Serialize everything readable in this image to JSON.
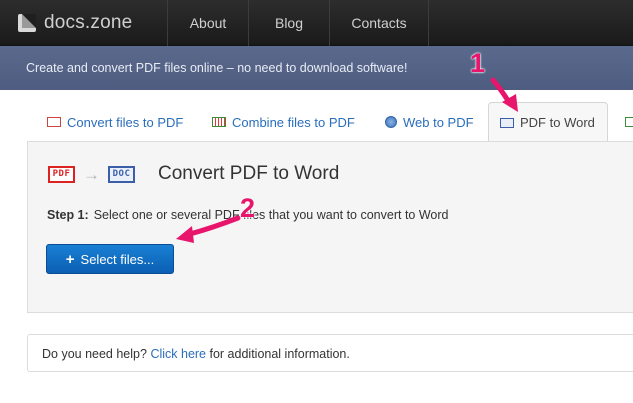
{
  "header": {
    "logo_text": "docs.zone",
    "nav": [
      {
        "label": "About"
      },
      {
        "label": "Blog"
      },
      {
        "label": "Contacts"
      }
    ]
  },
  "banner": {
    "text": "Create and convert PDF files online – no need to download software!"
  },
  "tabs": [
    {
      "label": "Convert files to PDF",
      "icon": "pdf-file-icon"
    },
    {
      "label": "Combine files to PDF",
      "icon": "combine-files-icon"
    },
    {
      "label": "Web to PDF",
      "icon": "web-globe-icon"
    },
    {
      "label": "PDF to Word",
      "icon": "doc-file-icon",
      "active": true
    }
  ],
  "panel": {
    "icon_from": "PDF",
    "icon_to": "DOC",
    "title": "Convert PDF to Word",
    "step_label": "Step 1:",
    "step_text": "Select one or several PDF files that you want to convert to Word",
    "select_button": "Select files..."
  },
  "help": {
    "prefix": "Do you need help?",
    "link": "Click here",
    "suffix": "for additional information."
  },
  "annotations": {
    "one": "1",
    "two": "2",
    "color": "#e8156c"
  },
  "colors": {
    "nav_bg": "#1f1f1f",
    "banner_bg": "#55658a",
    "link": "#2a6ebb",
    "button": "#0d63b8"
  }
}
